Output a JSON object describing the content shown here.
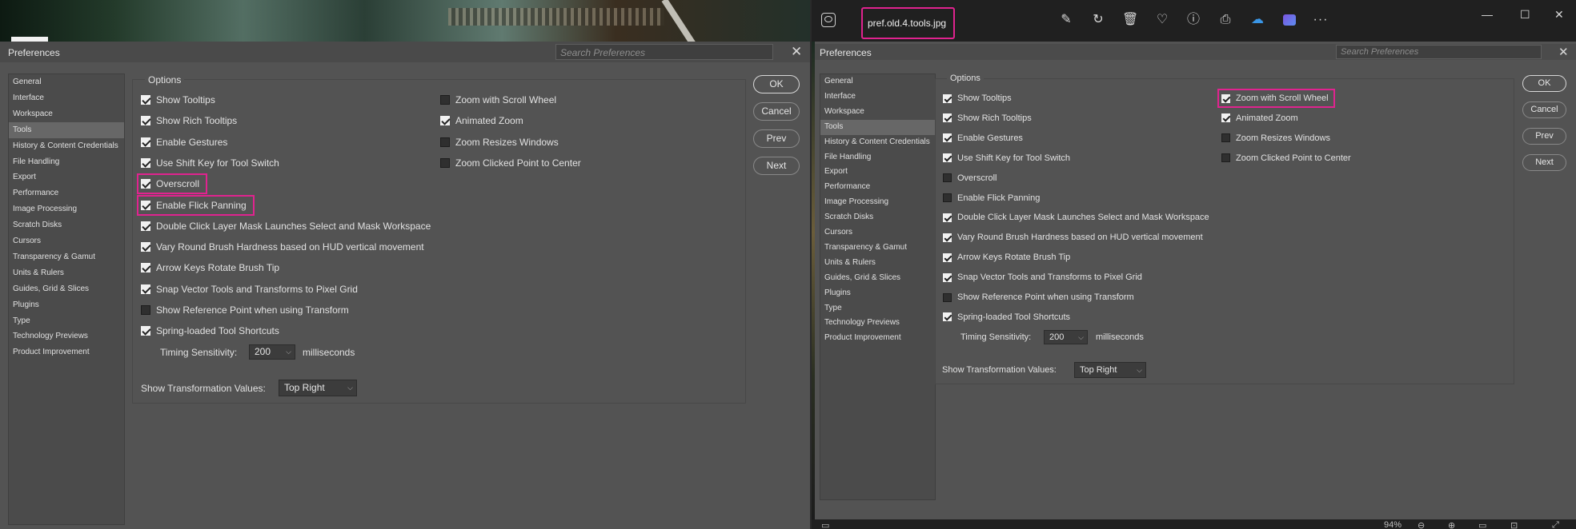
{
  "left": {
    "dialog_title": "Preferences",
    "search_placeholder": "Search Preferences",
    "close_glyph": "✕",
    "options_legend": "Options",
    "sidebar": [
      {
        "label": "General",
        "selected": false
      },
      {
        "label": "Interface",
        "selected": false
      },
      {
        "label": "Workspace",
        "selected": false
      },
      {
        "label": "Tools",
        "selected": true
      },
      {
        "label": "History & Content Credentials",
        "selected": false
      },
      {
        "label": "File Handling",
        "selected": false
      },
      {
        "label": "Export",
        "selected": false
      },
      {
        "label": "Performance",
        "selected": false
      },
      {
        "label": "Image Processing",
        "selected": false
      },
      {
        "label": "Scratch Disks",
        "selected": false
      },
      {
        "label": "Cursors",
        "selected": false
      },
      {
        "label": "Transparency & Gamut",
        "selected": false
      },
      {
        "label": "Units & Rulers",
        "selected": false
      },
      {
        "label": "Guides, Grid & Slices",
        "selected": false
      },
      {
        "label": "Plugins",
        "selected": false
      },
      {
        "label": "Type",
        "selected": false
      },
      {
        "label": "Technology Previews",
        "selected": false
      },
      {
        "label": "Product Improvement",
        "selected": false
      }
    ],
    "options_col1": [
      {
        "label": "Show Tooltips",
        "checked": true,
        "highlighted": false
      },
      {
        "label": "Show Rich Tooltips",
        "checked": true,
        "highlighted": false
      },
      {
        "label": "Enable Gestures",
        "checked": true,
        "highlighted": false
      },
      {
        "label": "Use Shift Key for Tool Switch",
        "checked": true,
        "highlighted": false
      },
      {
        "label": "Overscroll",
        "checked": true,
        "highlighted": true
      },
      {
        "label": "Enable Flick Panning",
        "checked": true,
        "highlighted": true
      },
      {
        "label": "Double Click Layer Mask Launches Select and Mask Workspace",
        "checked": true,
        "highlighted": false
      },
      {
        "label": "Vary Round Brush Hardness based on HUD vertical movement",
        "checked": true,
        "highlighted": false
      },
      {
        "label": "Arrow Keys Rotate Brush Tip",
        "checked": true,
        "highlighted": false
      },
      {
        "label": "Snap Vector Tools and Transforms to Pixel Grid",
        "checked": true,
        "highlighted": false
      },
      {
        "label": "Show Reference Point when using Transform",
        "checked": false,
        "highlighted": false
      },
      {
        "label": "Spring-loaded Tool Shortcuts",
        "checked": true,
        "highlighted": false
      }
    ],
    "options_col2": [
      {
        "label": "Zoom with Scroll Wheel",
        "checked": false,
        "highlighted": false
      },
      {
        "label": "Animated Zoom",
        "checked": true,
        "highlighted": false
      },
      {
        "label": "Zoom Resizes Windows",
        "checked": false,
        "highlighted": false
      },
      {
        "label": "Zoom Clicked Point to Center",
        "checked": false,
        "highlighted": false
      }
    ],
    "timing": {
      "label": "Timing Sensitivity:",
      "value": "200",
      "unit": "milliseconds"
    },
    "transform": {
      "label": "Show Transformation Values:",
      "value": "Top Right"
    },
    "buttons": {
      "ok": "OK",
      "cancel": "Cancel",
      "prev": "Prev",
      "next": "Next"
    }
  },
  "right": {
    "filename": "pref.old.4.tools.jpg",
    "toolbar_icons": [
      "edit-icon",
      "rotate-icon",
      "delete-icon",
      "favorite-icon",
      "info-icon",
      "print-icon",
      "onedrive-icon",
      "clipchamp-icon",
      "more-icon"
    ],
    "more_glyph": "···",
    "window_controls": {
      "minimize": "—",
      "maximize": "☐",
      "close": "✕"
    },
    "dialog_title": "Preferences",
    "search_placeholder": "Search Preferences",
    "close_glyph": "✕",
    "options_legend": "Options",
    "sidebar": [
      {
        "label": "General",
        "selected": false
      },
      {
        "label": "Interface",
        "selected": false
      },
      {
        "label": "Workspace",
        "selected": false
      },
      {
        "label": "Tools",
        "selected": true
      },
      {
        "label": "History & Content Credentials",
        "selected": false
      },
      {
        "label": "File Handling",
        "selected": false
      },
      {
        "label": "Export",
        "selected": false
      },
      {
        "label": "Performance",
        "selected": false
      },
      {
        "label": "Image Processing",
        "selected": false
      },
      {
        "label": "Scratch Disks",
        "selected": false
      },
      {
        "label": "Cursors",
        "selected": false
      },
      {
        "label": "Transparency & Gamut",
        "selected": false
      },
      {
        "label": "Units & Rulers",
        "selected": false
      },
      {
        "label": "Guides, Grid & Slices",
        "selected": false
      },
      {
        "label": "Plugins",
        "selected": false
      },
      {
        "label": "Type",
        "selected": false
      },
      {
        "label": "Technology Previews",
        "selected": false
      },
      {
        "label": "Product Improvement",
        "selected": false
      }
    ],
    "options_col1": [
      {
        "label": "Show Tooltips",
        "checked": true,
        "highlighted": false
      },
      {
        "label": "Show Rich Tooltips",
        "checked": true,
        "highlighted": false
      },
      {
        "label": "Enable Gestures",
        "checked": true,
        "highlighted": false
      },
      {
        "label": "Use Shift Key for Tool Switch",
        "checked": true,
        "highlighted": false
      },
      {
        "label": "Overscroll",
        "checked": false,
        "highlighted": false
      },
      {
        "label": "Enable Flick Panning",
        "checked": false,
        "highlighted": false
      },
      {
        "label": "Double Click Layer Mask Launches Select and Mask Workspace",
        "checked": true,
        "highlighted": false
      },
      {
        "label": "Vary Round Brush Hardness based on HUD vertical movement",
        "checked": true,
        "highlighted": false
      },
      {
        "label": "Arrow Keys Rotate Brush Tip",
        "checked": true,
        "highlighted": false
      },
      {
        "label": "Snap Vector Tools and Transforms to Pixel Grid",
        "checked": true,
        "highlighted": false
      },
      {
        "label": "Show Reference Point when using Transform",
        "checked": false,
        "highlighted": false
      },
      {
        "label": "Spring-loaded Tool Shortcuts",
        "checked": true,
        "highlighted": false
      }
    ],
    "options_col2": [
      {
        "label": "Zoom with Scroll Wheel",
        "checked": true,
        "highlighted": true
      },
      {
        "label": "Animated Zoom",
        "checked": true,
        "highlighted": false
      },
      {
        "label": "Zoom Resizes Windows",
        "checked": false,
        "highlighted": false
      },
      {
        "label": "Zoom Clicked Point to Center",
        "checked": false,
        "highlighted": false
      }
    ],
    "timing": {
      "label": "Timing Sensitivity:",
      "value": "200",
      "unit": "milliseconds"
    },
    "transform": {
      "label": "Show Transformation Values:",
      "value": "Top Right"
    },
    "buttons": {
      "ok": "OK",
      "cancel": "Cancel",
      "prev": "Prev",
      "next": "Next"
    },
    "zoom_text": "94%"
  },
  "colors": {
    "highlight": "#e0238f",
    "panel": "#535353",
    "viewer_bg": "#202020"
  }
}
